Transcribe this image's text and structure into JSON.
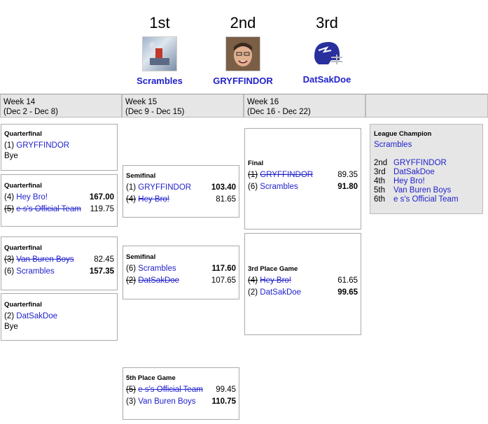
{
  "podium": [
    {
      "place": "1st",
      "team": "Scrambles"
    },
    {
      "place": "2nd",
      "team": "GRYFFINDOR"
    },
    {
      "place": "3rd",
      "team": "DatSakDoe"
    }
  ],
  "weeks": [
    {
      "label": "Week 14",
      "dates": "(Dec 2 - Dec 8)"
    },
    {
      "label": "Week 15",
      "dates": "(Dec 9 - Dec 15)"
    },
    {
      "label": "Week 16",
      "dates": "(Dec 16 - Dec 22)"
    }
  ],
  "week14": {
    "qf1": {
      "title": "Quarterfinal",
      "seed": "(1)",
      "team": "GRYFFINDOR",
      "bye": "Bye"
    },
    "qf2": {
      "title": "Quarterfinal",
      "a": {
        "seed": "(4)",
        "team": "Hey Bro!",
        "score": "167.00"
      },
      "b": {
        "seed": "(5)",
        "team": "e s's Official Team",
        "score": "119.75"
      }
    },
    "qf3": {
      "title": "Quarterfinal",
      "a": {
        "seed": "(3)",
        "team": "Van Buren Boys",
        "score": "82.45"
      },
      "b": {
        "seed": "(6)",
        "team": "Scrambles",
        "score": "157.35"
      }
    },
    "qf4": {
      "title": "Quarterfinal",
      "seed": "(2)",
      "team": "DatSakDoe",
      "bye": "Bye"
    }
  },
  "week15": {
    "sf1": {
      "title": "Semifinal",
      "a": {
        "seed": "(1)",
        "team": "GRYFFINDOR",
        "score": "103.40"
      },
      "b": {
        "seed": "(4)",
        "team": "Hey Bro!",
        "score": "81.65"
      }
    },
    "sf2": {
      "title": "Semifinal",
      "a": {
        "seed": "(6)",
        "team": "Scrambles",
        "score": "117.60"
      },
      "b": {
        "seed": "(2)",
        "team": "DatSakDoe",
        "score": "107.65"
      }
    },
    "fifth": {
      "title": "5th Place Game",
      "a": {
        "seed": "(5)",
        "team": "e s's Official Team",
        "score": "99.45"
      },
      "b": {
        "seed": "(3)",
        "team": "Van Buren Boys",
        "score": "110.75"
      }
    }
  },
  "week16": {
    "final": {
      "title": "Final",
      "a": {
        "seed": "(1)",
        "team": "GRYFFINDOR",
        "score": "89.35"
      },
      "b": {
        "seed": "(6)",
        "team": "Scrambles",
        "score": "91.80"
      }
    },
    "third": {
      "title": "3rd Place Game",
      "a": {
        "seed": "(4)",
        "team": "Hey Bro!",
        "score": "61.65"
      },
      "b": {
        "seed": "(2)",
        "team": "DatSakDoe",
        "score": "99.65"
      }
    }
  },
  "champion": {
    "title": "League Champion",
    "team": "Scrambles",
    "ranks": [
      {
        "rank": "2nd",
        "team": "GRYFFINDOR"
      },
      {
        "rank": "3rd",
        "team": "DatSakDoe"
      },
      {
        "rank": "4th",
        "team": "Hey Bro!"
      },
      {
        "rank": "5th",
        "team": "Van Buren Boys"
      },
      {
        "rank": "6th",
        "team": "e s's Official Team"
      }
    ]
  }
}
